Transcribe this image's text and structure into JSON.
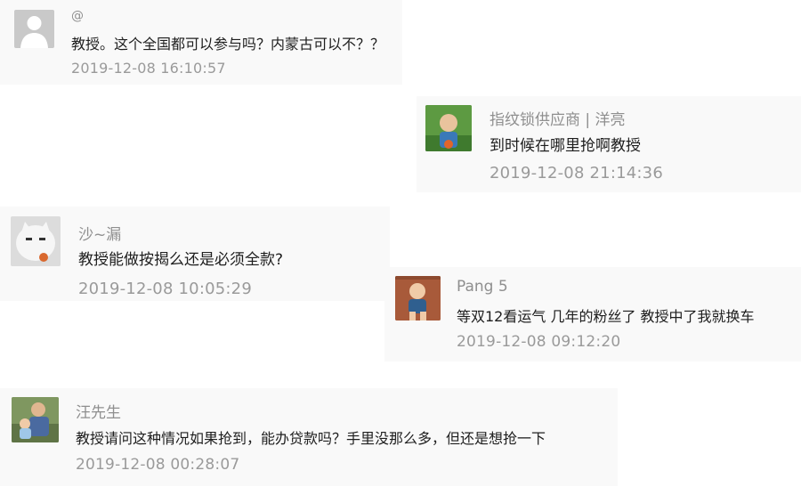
{
  "comments": [
    {
      "name": "@",
      "text": "教授。这个全国都可以参与吗？内蒙古可以不？？",
      "time": "2019-12-08 16:10:57",
      "avatar": "default-avatar-icon"
    },
    {
      "name": "指纹锁供应商 | 洋亮",
      "text": "到时候在哪里抢啊教授",
      "time": "2019-12-08 21:14:36",
      "avatar": "child-photo-avatar"
    },
    {
      "name": "沙~漏",
      "text": "教授能做按揭么还是必须全款?",
      "time": "2019-12-08 10:05:29",
      "avatar": "cartoon-cat-avatar"
    },
    {
      "name": "Pang 5",
      "text": "等双12看运气 几年的粉丝了 教授中了我就换车",
      "time": "2019-12-08 09:12:20",
      "avatar": "child-photo-avatar"
    },
    {
      "name": "汪先生",
      "text": "教授请问这种情况如果抢到，能办贷款吗？手里没那么多，但还是想抢一下",
      "time": "2019-12-08 00:28:07",
      "avatar": "man-child-photo-avatar"
    }
  ]
}
